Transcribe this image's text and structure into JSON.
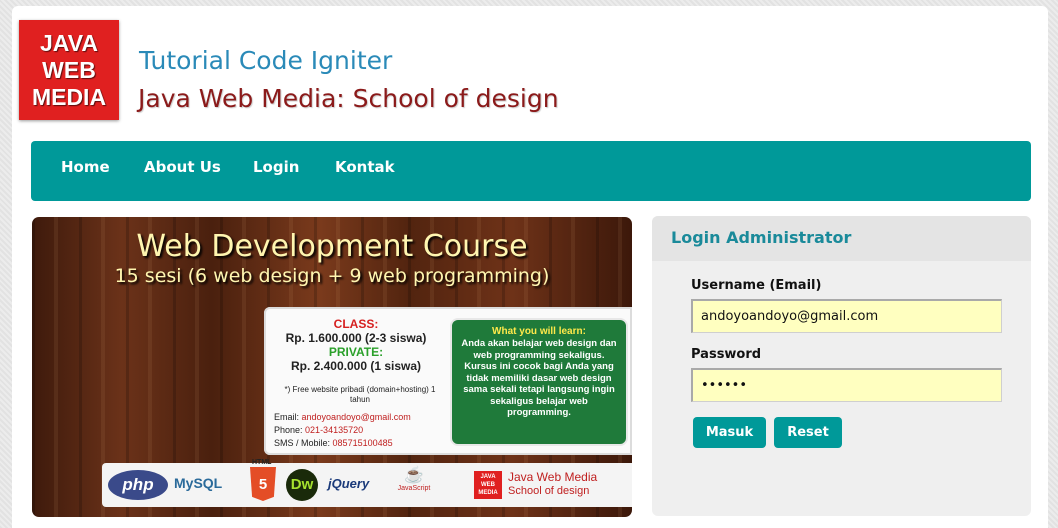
{
  "header": {
    "logo_lines": [
      "JAVA",
      "WEB",
      "MEDIA"
    ],
    "title": "Tutorial Code Igniter",
    "subtitle": "Java Web Media: School of design"
  },
  "nav": {
    "items": [
      {
        "label": "Home"
      },
      {
        "label": "About Us"
      },
      {
        "label": "Login"
      },
      {
        "label": "Kontak"
      }
    ]
  },
  "banner": {
    "title": "Web Development Course",
    "subtitle": "15 sesi (6 web design + 9 web programming)",
    "class_label": "CLASS:",
    "class_price": "Rp. 1.600.000 (2-3 siswa)",
    "private_label": "PRIVATE:",
    "private_price": "Rp. 2.400.000 (1 siswa)",
    "note": "*) Free website pribadi (domain+hosting) 1 tahun",
    "email_label": "Email:",
    "email_value": "andoyoandoyo@gmail.com",
    "phone_label": "Phone:",
    "phone_value": "021-34135720",
    "sms_label": "SMS / Mobile:",
    "sms_value": "085715100485",
    "learn_title": "What you will learn:",
    "learn_body": "Anda akan belajar web design dan web programming sekaligus. Kursus ini cocok bagi Anda yang tidak memiliki dasar web design sama sekali tetapi langsung ingin sekaligus belajar web programming.",
    "tech_php": "php",
    "tech_mysql": "MySQL",
    "tech_html5": "5",
    "tech_html_label": "HTML",
    "tech_dw": "Dw",
    "tech_jquery": "jQuery",
    "tech_js": "JavaScript",
    "mini_logo": "JAVA WEB MEDIA",
    "jwm_name": "Java Web Media",
    "jwm_sub": "School of design"
  },
  "login": {
    "header": "Login Administrator",
    "username_label": "Username (Email)",
    "username_value": "andoyoandoyo@gmail.com",
    "password_label": "Password",
    "password_value": "••••••",
    "submit_label": "Masuk",
    "reset_label": "Reset"
  },
  "colors": {
    "accent": "#009999",
    "title_blue": "#2a8ab8",
    "subtitle_red": "#8b1a1a",
    "input_bg": "#ffffc0"
  }
}
